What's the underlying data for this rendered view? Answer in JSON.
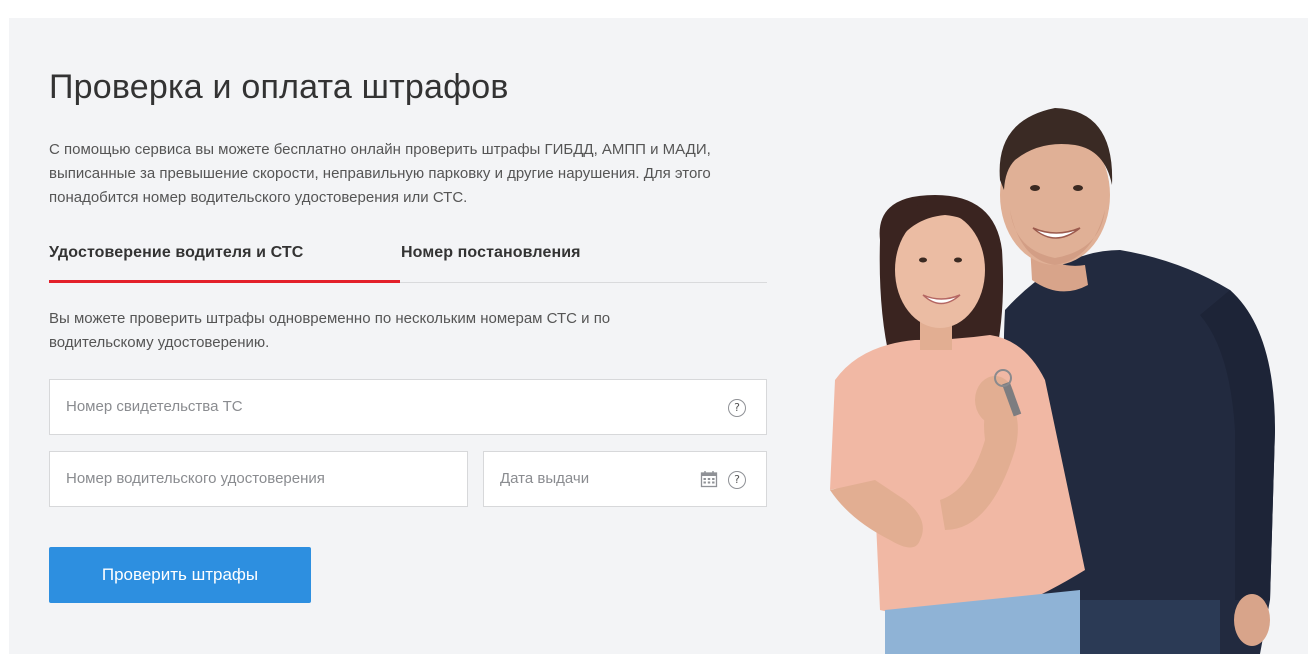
{
  "page": {
    "title": "Проверка и оплата штрафов",
    "description": "С помощью сервиса вы можете бесплатно онлайн проверить штрафы ГИБДД, АМПП и МАДИ, выписанные за превышение скорости, неправильную парковку и другие нарушения. Для этого понадобится номер водительского удостоверения или СТС."
  },
  "tabs": [
    {
      "label": "Удостоверение водителя и СТС",
      "active": true
    },
    {
      "label": "Номер постановления",
      "active": false
    }
  ],
  "form": {
    "hint": "Вы можете проверить штрафы одновременно по нескольким номерам СТС и по водительскому удостоверению.",
    "sts_placeholder": "Номер свидетельства ТС",
    "license_placeholder": "Номер водительского удостоверения",
    "date_placeholder": "Дата выдачи",
    "help_glyph": "?",
    "submit_label": "Проверить штрафы"
  },
  "colors": {
    "accent_tab": "#e3202b",
    "button": "#2d8fe0",
    "panel_bg": "#f3f4f6"
  },
  "icons": [
    "help-icon",
    "calendar-icon"
  ]
}
